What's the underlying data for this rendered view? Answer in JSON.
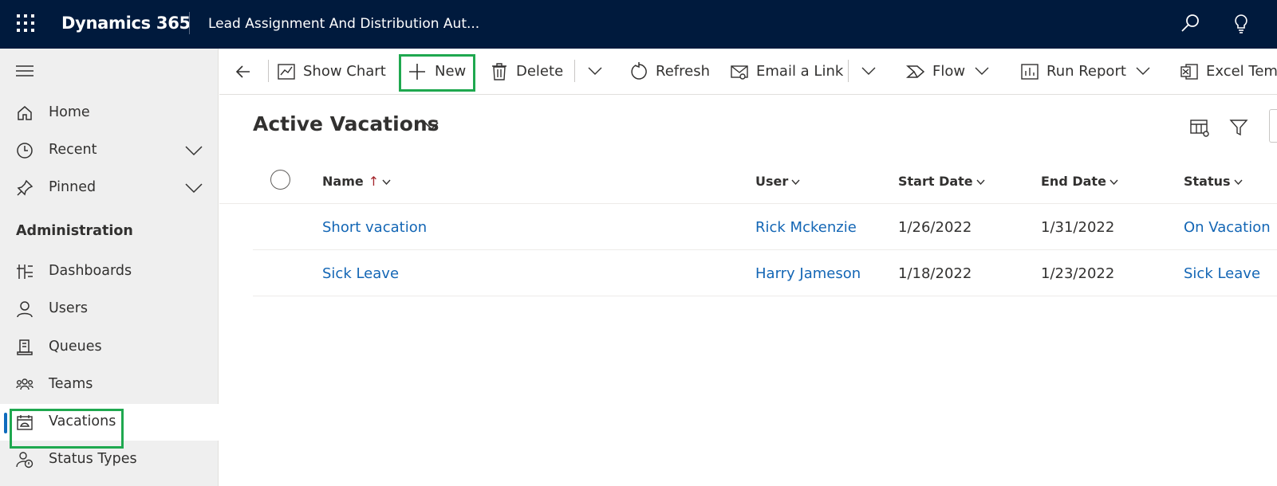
{
  "header": {
    "app_name": "Dynamics 365",
    "app_title": "Lead Assignment And Distribution Aut..."
  },
  "sidebar": {
    "items": [
      {
        "label": "Home"
      },
      {
        "label": "Recent"
      },
      {
        "label": "Pinned"
      }
    ],
    "section_title": "Administration",
    "admin_items": [
      {
        "label": "Dashboards"
      },
      {
        "label": "Users"
      },
      {
        "label": "Queues"
      },
      {
        "label": "Teams"
      },
      {
        "label": "Vacations"
      },
      {
        "label": "Status Types"
      }
    ]
  },
  "toolbar": {
    "show_chart": "Show Chart",
    "new": "New",
    "delete": "Delete",
    "refresh": "Refresh",
    "email_link": "Email a Link",
    "flow": "Flow",
    "run_report": "Run Report",
    "excel_templates": "Excel Temp"
  },
  "view": {
    "title": "Active Vacations"
  },
  "grid": {
    "columns": [
      "Name",
      "User",
      "Start Date",
      "End Date",
      "Status"
    ],
    "sort_indicator": "↑",
    "rows": [
      {
        "name": "Short vacation",
        "user": "Rick Mckenzie",
        "start": "1/26/2022",
        "end": "1/31/2022",
        "status": "On Vacation"
      },
      {
        "name": "Sick Leave",
        "user": "Harry Jameson",
        "start": "1/18/2022",
        "end": "1/23/2022",
        "status": "Sick Leave"
      }
    ]
  },
  "colors": {
    "topbar": "#001a3d",
    "link": "#1366b5",
    "highlight": "#1fa84f",
    "selected_indicator": "#0f6cbd"
  }
}
